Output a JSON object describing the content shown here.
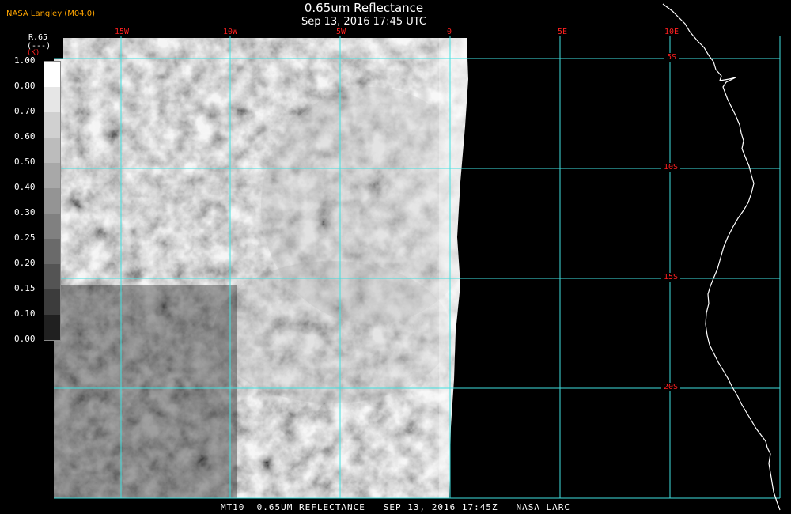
{
  "header": {
    "title": "0.65um Reflectance",
    "datetime": "Sep 13, 2016 17:45 UTC",
    "credit": "NASA Langley (M04.0)"
  },
  "footer": {
    "text": "MT10  0.65UM REFLECTANCE   SEP 13, 2016 17:45Z   NASA LARC"
  },
  "colorbar": {
    "name": "R.65",
    "units": "(---)",
    "k_label": "(K)",
    "ticks": [
      "1.00",
      "0.80",
      "0.70",
      "0.60",
      "0.50",
      "0.40",
      "0.30",
      "0.25",
      "0.20",
      "0.15",
      "0.10",
      "0.00"
    ]
  },
  "grid": {
    "longitude_labels": [
      "15W",
      "10W",
      "5W",
      "0",
      "5E",
      "10E"
    ],
    "latitude_labels": [
      "5S",
      "10S",
      "15S",
      "20S"
    ],
    "line_color": "#40e0e0",
    "label_color": "#ff2020"
  },
  "image": {
    "product": "0.65um reflectance",
    "colormap": "grayscale",
    "notes_visible": "cloud field over ocean, data cut-off near 0 longitude, coastline on right"
  }
}
